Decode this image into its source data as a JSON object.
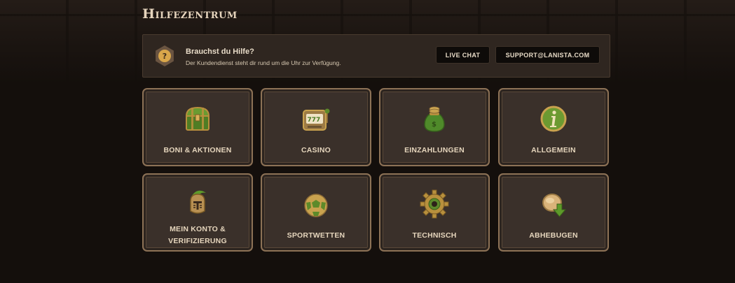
{
  "page": {
    "title": "Hilfezentrum"
  },
  "help": {
    "heading": "Brauchst du Hilfe?",
    "subtext": "Der Kundendienst steht dir rund um die Uhr zur Verfügung.",
    "live_chat_label": "LIVE CHAT",
    "email_label": "SUPPORT@LANISTA.COM",
    "icon": "question-icon"
  },
  "categories": [
    {
      "label": "BONI & AKTIONEN",
      "icon": "treasure-chest-icon"
    },
    {
      "label": "CASINO",
      "icon": "slot-machine-icon"
    },
    {
      "label": "EINZAHLUNGEN",
      "icon": "money-bag-icon"
    },
    {
      "label": "ALLGEMEIN",
      "icon": "info-icon"
    },
    {
      "label": "MEIN KONTO & VERIFIZIERUNG",
      "icon": "gladiator-helmet-icon"
    },
    {
      "label": "SPORTWETTEN",
      "icon": "football-icon"
    },
    {
      "label": "TECHNISCH",
      "icon": "gear-icon"
    },
    {
      "label": "ABHEBUGEN",
      "icon": "coin-withdraw-icon"
    }
  ],
  "colors": {
    "background": "#140f0c",
    "card": "#3a302a",
    "card_border": "#8d7256",
    "text": "#e6d6bd",
    "accent_green": "#5d8a2a",
    "gold": "#c9a24e"
  }
}
